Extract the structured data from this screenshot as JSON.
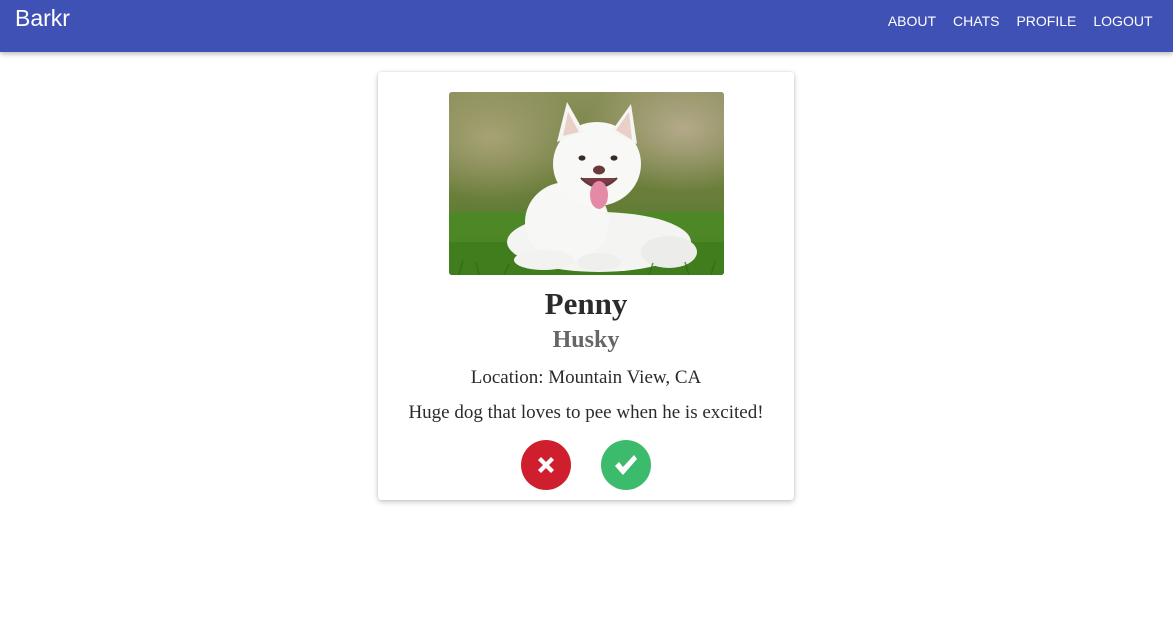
{
  "app": {
    "brand": "Barkr",
    "nav": [
      {
        "label": "ABOUT"
      },
      {
        "label": "CHATS"
      },
      {
        "label": "PROFILE"
      },
      {
        "label": "LOGOUT"
      }
    ],
    "colors": {
      "navbar": "#3f51b5",
      "reject": "#cf1f2e",
      "accept": "#3dbb6c"
    }
  },
  "profile_card": {
    "photo_icon": "white-dog-photo",
    "name": "Penny",
    "breed": "Husky",
    "location": "Location: Mountain View, CA",
    "bio": "Huge dog that loves to pee when he is excited!",
    "reject_icon": "x-mark-icon",
    "accept_icon": "check-mark-icon"
  }
}
